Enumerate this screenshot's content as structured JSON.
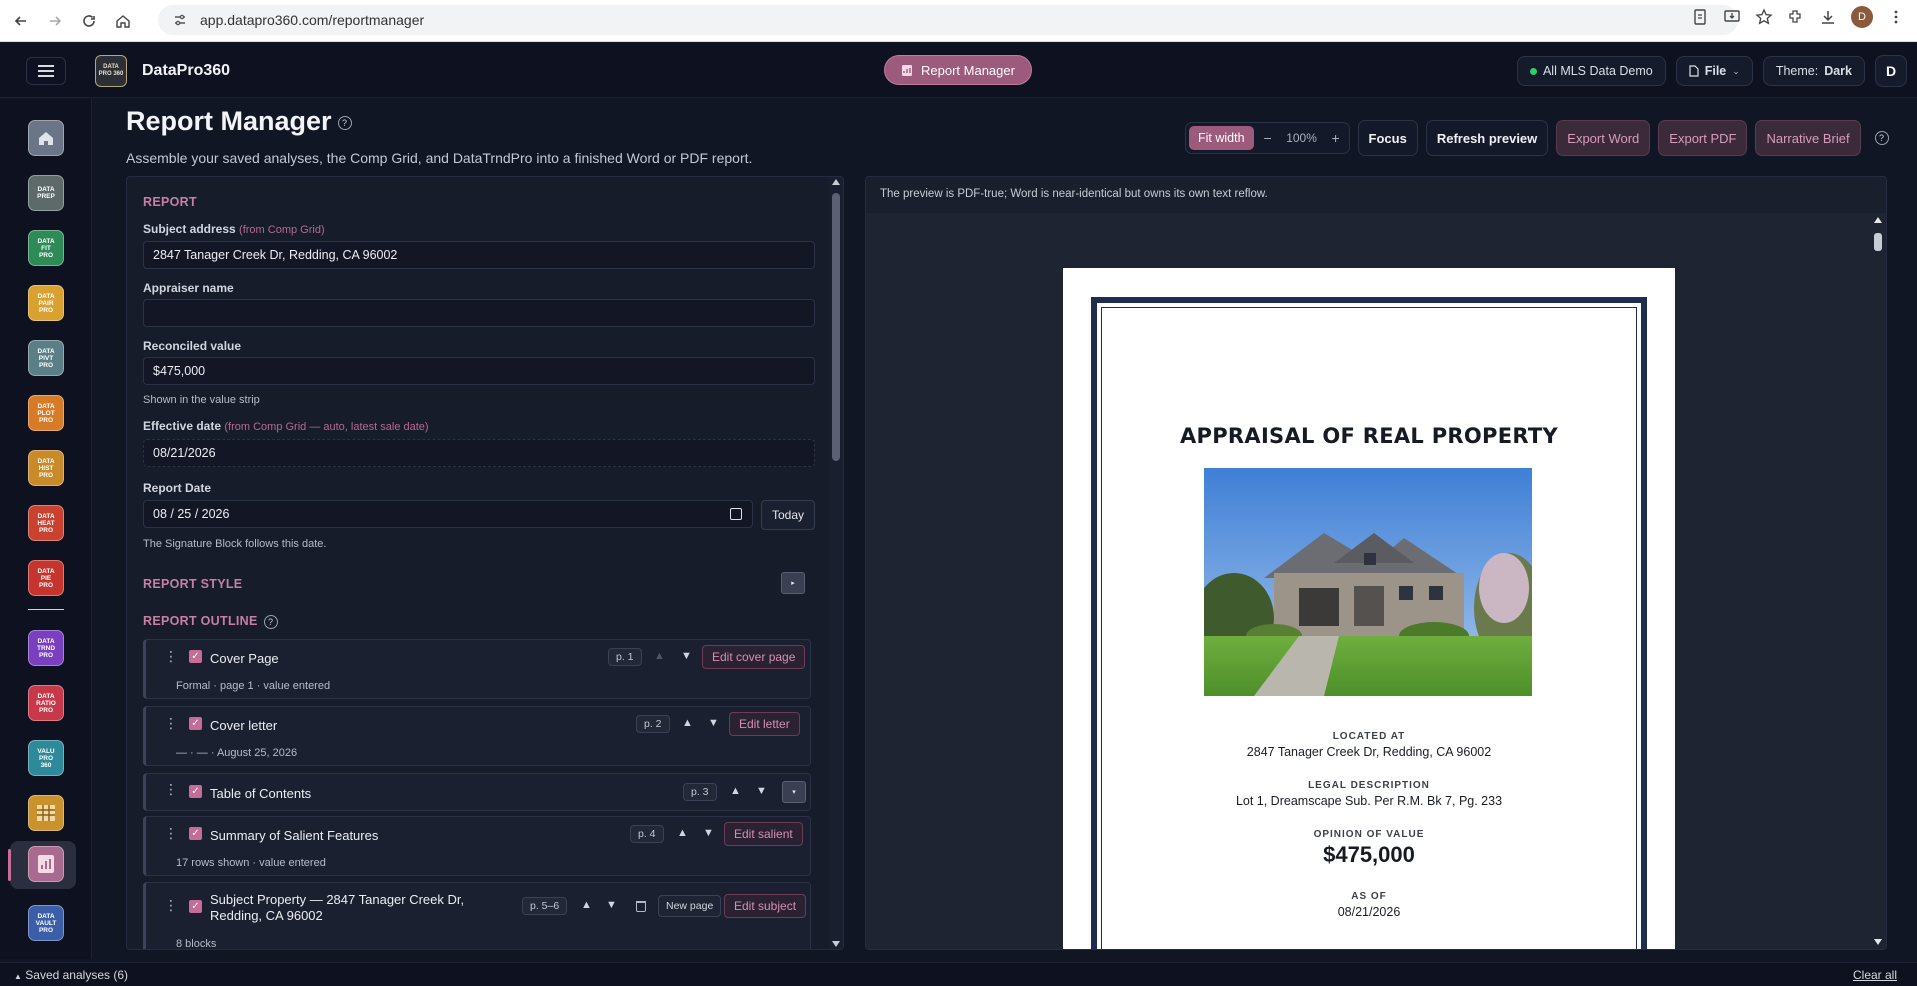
{
  "browser": {
    "url": "app.datapro360.com/reportmanager",
    "avatar_letter": "D"
  },
  "header": {
    "logo_text": "DATA PRO 360",
    "app_name": "DataPro360",
    "active_module": "Report Manager",
    "mls_label": "All MLS Data Demo",
    "file_label": "File",
    "theme_label": "Theme:",
    "theme_value": "Dark",
    "user_initial": "D"
  },
  "rail": {
    "items": [
      {
        "name": "home",
        "label": "",
        "color": "#6b7588"
      },
      {
        "name": "data-prep",
        "label": "DATA PREP",
        "color": "#5e6a6a"
      },
      {
        "name": "data-fit-pro",
        "label": "DATA FIT PRO",
        "color": "#2e8b57"
      },
      {
        "name": "data-pair-pro",
        "label": "DATA PAIR PRO",
        "color": "#d9a130"
      },
      {
        "name": "data-pivt-pro",
        "label": "DATA PIVT PRO",
        "color": "#5b7f86"
      },
      {
        "name": "data-plot-pro",
        "label": "DATA PLOT PRO",
        "color": "#d77c26"
      },
      {
        "name": "data-hist-pro",
        "label": "DATA HIST PRO",
        "color": "#c98a2a"
      },
      {
        "name": "data-heat-pro",
        "label": "DATA HEAT PRO",
        "color": "#c9412f"
      },
      {
        "name": "data-pie-pro",
        "label": "DATA PIE PRO",
        "color": "#c5352d"
      },
      {
        "name": "data-trnd-pro",
        "label": "DATA TRND PRO",
        "color": "#7a3fbe"
      },
      {
        "name": "data-ratio-pro",
        "label": "DATA RATIO PRO",
        "color": "#c6384a"
      },
      {
        "name": "valu-pro-360",
        "label": "VALU PRO 360",
        "color": "#2e8a9a"
      },
      {
        "name": "comp-grid",
        "label": "",
        "color": "#c9922d"
      },
      {
        "name": "report-manager",
        "label": "",
        "color": "#a86a8e"
      },
      {
        "name": "data-vault-pro",
        "label": "DATA VAULT PRO",
        "color": "#3a5ea8"
      }
    ]
  },
  "page": {
    "title": "Report Manager",
    "help": "?",
    "subtitle": "Assemble your saved analyses, the Comp Grid, and DataTrndPro into a finished Word or PDF report."
  },
  "toolbar": {
    "fit_width": "Fit width",
    "zoom_minus": "−",
    "zoom_value": "100%",
    "zoom_plus": "+",
    "focus": "Focus",
    "refresh": "Refresh preview",
    "export_word": "Export Word",
    "export_pdf": "Export PDF",
    "narrative": "Narrative Brief",
    "help": "?"
  },
  "form": {
    "section_report": "REPORT",
    "subject_label": "Subject address",
    "subject_hint": "(from Comp Grid)",
    "subject_value": "2847 Tanager Creek Dr, Redding, CA 96002",
    "appraiser_label": "Appraiser name",
    "appraiser_value": "",
    "reconciled_label": "Reconciled value",
    "reconciled_value": "$475,000",
    "reconciled_note": "Shown in the value strip",
    "effective_label": "Effective date",
    "effective_hint": "(from Comp Grid — auto, latest sale date)",
    "effective_value": "08/21/2026",
    "report_date_label": "Report Date",
    "report_date_value": "08 / 25 / 2026",
    "today_label": "Today",
    "report_date_note": "The Signature Block follows this date.",
    "section_style": "REPORT STYLE",
    "section_outline": "REPORT OUTLINE",
    "outline_help": "?"
  },
  "outline": [
    {
      "title": "Cover Page",
      "sub": "Formal · page 1 · value entered",
      "page": "p. 1",
      "edit": "Edit cover page"
    },
    {
      "title": "Cover letter",
      "sub": "— · — · August 25, 2026",
      "page": "p. 2",
      "edit": "Edit letter"
    },
    {
      "title": "Table of Contents",
      "sub": "",
      "page": "p. 3",
      "edit": ""
    },
    {
      "title": "Summary of Salient Features",
      "sub": "17 rows shown · value entered",
      "page": "p. 4",
      "edit": "Edit salient"
    },
    {
      "title_line1": "Subject Property — 2847 Tanager Creek Dr,",
      "title_line2": "Redding, CA 96002",
      "sub": "8 blocks",
      "page": "p. 5–6",
      "new_page": "New page",
      "edit": "Edit subject"
    }
  ],
  "preview": {
    "note": "The preview is PDF-true; Word is near-identical but owns its own text reflow.",
    "doc_title": "APPRAISAL OF REAL PROPERTY",
    "located_label": "LOCATED AT",
    "located_value": "2847 Tanager Creek Dr, Redding, CA 96002",
    "legal_label": "LEGAL DESCRIPTION",
    "legal_value": "Lot 1, Dreamscape Sub. Per R.M. Bk 7, Pg. 233",
    "opinion_label": "OPINION OF VALUE",
    "opinion_value": "$475,000",
    "asof_label": "AS OF",
    "asof_value": "08/21/2026"
  },
  "bottom": {
    "saved": "Saved analyses (6)",
    "clear": "Clear all"
  }
}
